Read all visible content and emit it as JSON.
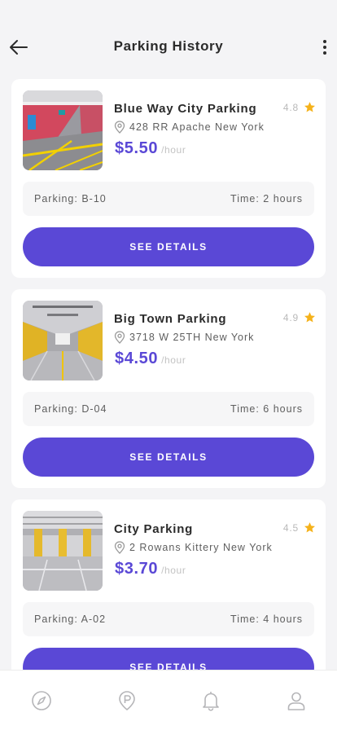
{
  "header": {
    "title": "Parking History",
    "back_icon": "arrow-left-icon",
    "more_icon": "more-vertical-icon"
  },
  "colors": {
    "accent": "#5a48d6",
    "star": "#f5b21b",
    "background": "#f4f4f6",
    "card": "#ffffff"
  },
  "parkings": [
    {
      "name": "Blue Way City Parking",
      "rating": "4.8",
      "address": "428 RR Apache New York",
      "price": "$5.50",
      "unit": "/hour",
      "spot": "Parking: B-10",
      "time": "Time: 2 hours",
      "button": "SEE DETAILS"
    },
    {
      "name": "Big Town Parking",
      "rating": "4.9",
      "address": "3718 W 25TH New York",
      "price": "$4.50",
      "unit": "/hour",
      "spot": "Parking: D-04",
      "time": "Time: 6 hours",
      "button": "SEE DETAILS"
    },
    {
      "name": "City Parking",
      "rating": "4.5",
      "address": "2 Rowans Kittery New York",
      "price": "$3.70",
      "unit": "/hour",
      "spot": "Parking: A-02",
      "time": "Time: 4 hours",
      "button": "SEE DETAILS"
    }
  ],
  "bottom_nav": {
    "items": [
      "compass-icon",
      "parking-pin-icon",
      "bell-icon",
      "user-icon"
    ]
  }
}
